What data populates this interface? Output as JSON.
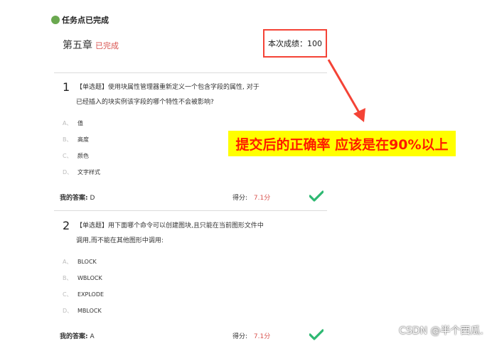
{
  "header": {
    "status": "任务点已完成"
  },
  "chapter": {
    "title": "第五章",
    "status": "已完成"
  },
  "score_box": {
    "text": "本次成绩：100"
  },
  "annotation": {
    "text": "提交后的正确率 应该是在90%以上"
  },
  "questions": [
    {
      "number": "1",
      "text_line1": "【单选题】使用块属性管理器重新定义一个包含字段的属性, 对于",
      "text_line2": "已经插入的块实例该字段的哪个特性不会被影响?",
      "options": [
        {
          "letter": "A、",
          "text": "值"
        },
        {
          "letter": "B、",
          "text": "高度"
        },
        {
          "letter": "C、",
          "text": "颜色"
        },
        {
          "letter": "D、",
          "text": "文字样式"
        }
      ],
      "my_answer_label": "我的答案:",
      "my_answer": "D",
      "score_label": "得分:",
      "score": "7.1分"
    },
    {
      "number": "2",
      "text_line1": "【单选题】用下面哪个命令可以创建图块,且只能在当前图形文件中",
      "text_line2": "调用,而不能在其他图形中调用:",
      "options": [
        {
          "letter": "A、",
          "text": "BLOCK"
        },
        {
          "letter": "B、",
          "text": "WBLOCK"
        },
        {
          "letter": "C、",
          "text": "EXPLODE"
        },
        {
          "letter": "D、",
          "text": "MBLOCK"
        }
      ],
      "my_answer_label": "我的答案:",
      "my_answer": "A",
      "score_label": "得分:",
      "score": "7.1分"
    }
  ],
  "watermark": "CSDN @半个西瓜.",
  "colors": {
    "accent_red": "#f44336",
    "check_green": "#2eb872",
    "annotation_bg": "#ffff00",
    "annotation_text": "#ff1a00"
  }
}
